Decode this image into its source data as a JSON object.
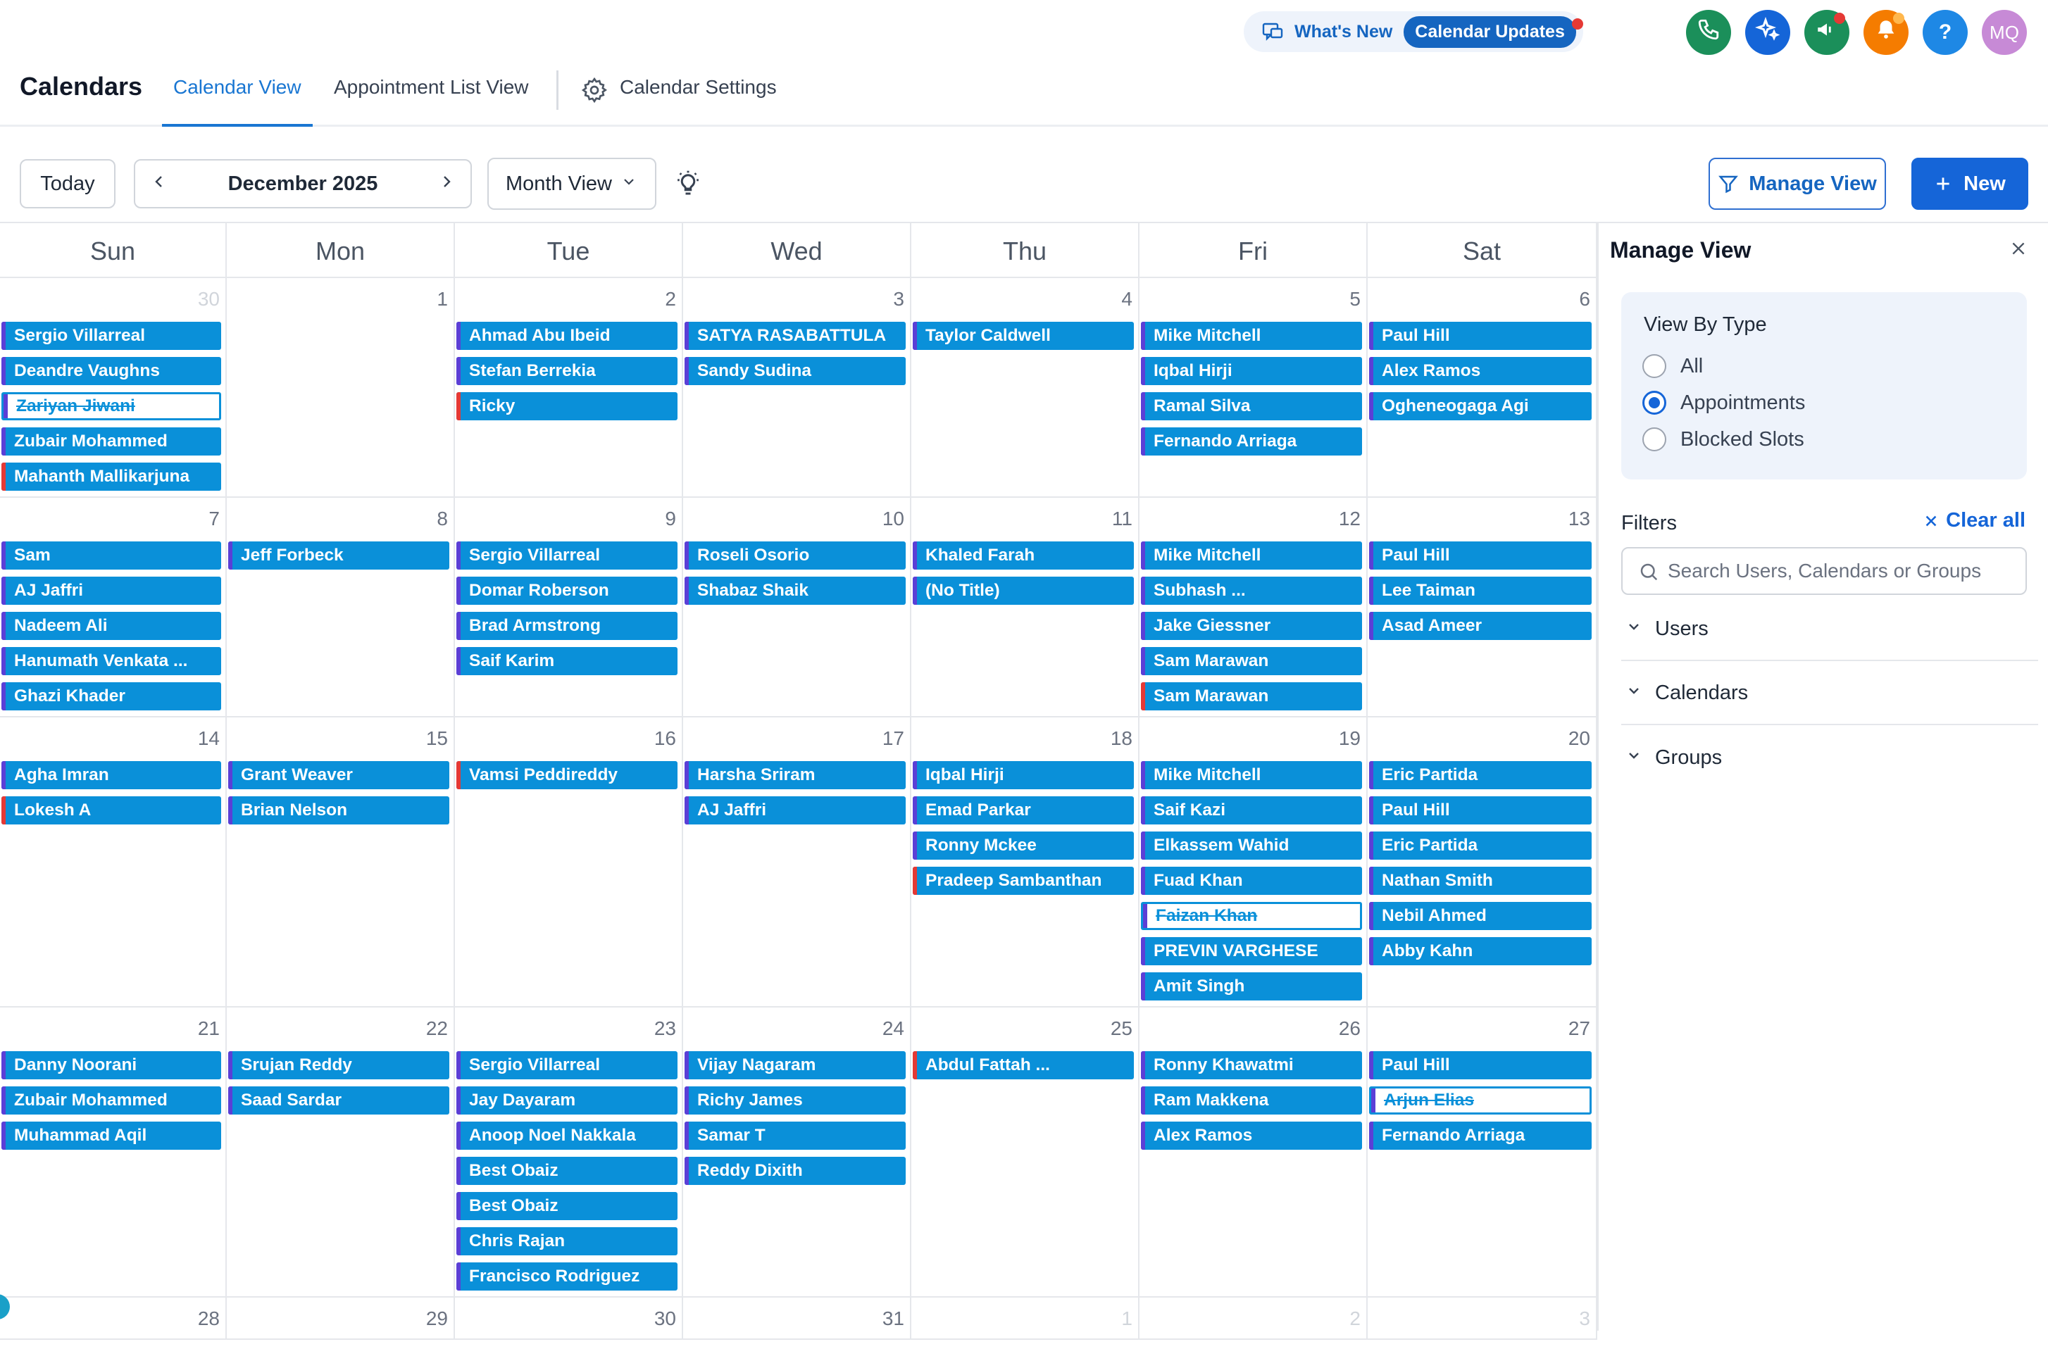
{
  "topbar": {
    "whats_new_label": "What's New",
    "calendar_updates_label": "Calendar Updates",
    "avatar_initials": "MQ",
    "help_label": "?",
    "icons": {
      "phone": {
        "name": "phone-icon",
        "color": "#1b8f5a"
      },
      "ai": {
        "name": "sparkle-icon",
        "color": "#1565d8"
      },
      "announce": {
        "name": "megaphone-icon",
        "color": "#1b8f5a"
      },
      "bell": {
        "name": "bell-icon",
        "color": "#f57c00"
      },
      "help": {
        "name": "help-icon",
        "color": "#1e88e5"
      },
      "avatar": {
        "color": "#c78ad6"
      }
    }
  },
  "header": {
    "title": "Calendars",
    "tabs": [
      "Calendar View",
      "Appointment List View",
      "Calendar Settings"
    ],
    "active_tab": "Calendar View"
  },
  "toolbar": {
    "today_label": "Today",
    "month_label": "December 2025",
    "view_label": "Month View",
    "manage_view_label": "Manage View",
    "new_label": "New"
  },
  "calendar": {
    "days_of_week": [
      "Sun",
      "Mon",
      "Tue",
      "Wed",
      "Thu",
      "Fri",
      "Sat"
    ],
    "weeks": [
      [
        {
          "num": "30",
          "muted": true,
          "events": [
            {
              "t": "Sergio Villarreal"
            },
            {
              "t": "Deandre Vaughns"
            },
            {
              "t": "Zariyan Jiwani",
              "s": "cancelled"
            },
            {
              "t": "Zubair Mohammed"
            },
            {
              "t": "Mahanth Mallikarjuna",
              "s": "red"
            }
          ]
        },
        {
          "num": "1",
          "events": []
        },
        {
          "num": "2",
          "events": [
            {
              "t": "Ahmad Abu Ibeid"
            },
            {
              "t": "Stefan Berrekia"
            },
            {
              "t": "Ricky",
              "s": "red"
            }
          ]
        },
        {
          "num": "3",
          "events": [
            {
              "t": "SATYA RASABATTULA"
            },
            {
              "t": "Sandy Sudina"
            }
          ]
        },
        {
          "num": "4",
          "events": [
            {
              "t": "Taylor  Caldwell"
            }
          ]
        },
        {
          "num": "5",
          "events": [
            {
              "t": "Mike Mitchell"
            },
            {
              "t": "Iqbal Hirji"
            },
            {
              "t": "Ramal Silva"
            },
            {
              "t": "Fernando Arriaga"
            }
          ]
        },
        {
          "num": "6",
          "events": [
            {
              "t": "Paul Hill"
            },
            {
              "t": "Alex Ramos"
            },
            {
              "t": "Ogheneogaga Agi"
            }
          ]
        }
      ],
      [
        {
          "num": "7",
          "events": [
            {
              "t": "Sam"
            },
            {
              "t": "AJ Jaffri"
            },
            {
              "t": "Nadeem Ali"
            },
            {
              "t": "Hanumath Venkata ..."
            },
            {
              "t": "Ghazi Khader"
            }
          ]
        },
        {
          "num": "8",
          "events": [
            {
              "t": "Jeff Forbeck"
            }
          ]
        },
        {
          "num": "9",
          "events": [
            {
              "t": "Sergio Villarreal"
            },
            {
              "t": "Domar Roberson"
            },
            {
              "t": "Brad Armstrong"
            },
            {
              "t": "Saif Karim"
            }
          ]
        },
        {
          "num": "10",
          "events": [
            {
              "t": "Roseli Osorio"
            },
            {
              "t": "Shabaz Shaik"
            }
          ]
        },
        {
          "num": "11",
          "events": [
            {
              "t": "Khaled Farah"
            },
            {
              "t": "(No Title)"
            }
          ]
        },
        {
          "num": "12",
          "events": [
            {
              "t": "Mike Mitchell"
            },
            {
              "t": "Subhash ..."
            },
            {
              "t": "Jake Giessner"
            },
            {
              "t": "Sam Marawan"
            },
            {
              "t": "Sam Marawan",
              "s": "red"
            }
          ]
        },
        {
          "num": "13",
          "events": [
            {
              "t": "Paul Hill"
            },
            {
              "t": "Lee Taiman"
            },
            {
              "t": "Asad Ameer"
            }
          ]
        }
      ],
      [
        {
          "num": "14",
          "events": [
            {
              "t": "Agha Imran"
            },
            {
              "t": "Lokesh A",
              "s": "red"
            }
          ]
        },
        {
          "num": "15",
          "events": [
            {
              "t": "Grant Weaver"
            },
            {
              "t": "Brian Nelson"
            }
          ]
        },
        {
          "num": "16",
          "events": [
            {
              "t": "Vamsi Peddireddy",
              "s": "red"
            }
          ]
        },
        {
          "num": "17",
          "events": [
            {
              "t": "Harsha Sriram"
            },
            {
              "t": "AJ Jaffri"
            }
          ]
        },
        {
          "num": "18",
          "events": [
            {
              "t": "Iqbal Hirji"
            },
            {
              "t": "Emad Parkar"
            },
            {
              "t": "Ronny Mckee"
            },
            {
              "t": "Pradeep Sambanthan",
              "s": "red"
            }
          ]
        },
        {
          "num": "19",
          "events": [
            {
              "t": "Mike Mitchell"
            },
            {
              "t": "Saif Kazi"
            },
            {
              "t": "Elkassem Wahid"
            },
            {
              "t": "Fuad Khan"
            },
            {
              "t": "Faizan Khan",
              "s": "cancelled"
            },
            {
              "t": "PREVIN VARGHESE"
            },
            {
              "t": "Amit Singh"
            }
          ]
        },
        {
          "num": "20",
          "events": [
            {
              "t": "Eric Partida"
            },
            {
              "t": "Paul Hill"
            },
            {
              "t": "Eric Partida"
            },
            {
              "t": "Nathan Smith"
            },
            {
              "t": "Nebil Ahmed"
            },
            {
              "t": "Abby Kahn"
            }
          ]
        }
      ],
      [
        {
          "num": "21",
          "events": [
            {
              "t": "Danny Noorani"
            },
            {
              "t": "Zubair Mohammed"
            },
            {
              "t": "Muhammad Aqil"
            }
          ]
        },
        {
          "num": "22",
          "events": [
            {
              "t": "Srujan Reddy"
            },
            {
              "t": "Saad Sardar"
            }
          ]
        },
        {
          "num": "23",
          "events": [
            {
              "t": "Sergio Villarreal"
            },
            {
              "t": "Jay Dayaram"
            },
            {
              "t": "Anoop Noel Nakkala"
            },
            {
              "t": "Best Obaiz"
            },
            {
              "t": "Best Obaiz"
            },
            {
              "t": "Chris Rajan"
            },
            {
              "t": "Francisco Rodriguez"
            }
          ]
        },
        {
          "num": "24",
          "events": [
            {
              "t": "Vijay Nagaram"
            },
            {
              "t": "Richy James"
            },
            {
              "t": "Samar T"
            },
            {
              "t": "Reddy Dixith"
            }
          ]
        },
        {
          "num": "25",
          "events": [
            {
              "t": "Abdul Fattah ...",
              "s": "red"
            }
          ]
        },
        {
          "num": "26",
          "events": [
            {
              "t": "Ronny Khawatmi"
            },
            {
              "t": "Ram Makkena"
            },
            {
              "t": "Alex Ramos"
            }
          ]
        },
        {
          "num": "27",
          "events": [
            {
              "t": "Paul Hill"
            },
            {
              "t": "Arjun Elias",
              "s": "cancelled"
            },
            {
              "t": "Fernando Arriaga"
            }
          ]
        }
      ],
      [
        {
          "num": "28",
          "events": []
        },
        {
          "num": "29",
          "events": []
        },
        {
          "num": "30",
          "events": []
        },
        {
          "num": "31",
          "events": []
        },
        {
          "num": "1",
          "muted": true,
          "events": []
        },
        {
          "num": "2",
          "muted": true,
          "events": []
        },
        {
          "num": "3",
          "muted": true,
          "events": []
        }
      ]
    ]
  },
  "panel": {
    "title": "Manage View",
    "view_by_type_label": "View By Type",
    "options": [
      "All",
      "Appointments",
      "Blocked Slots"
    ],
    "selected_option": "Appointments",
    "filters_label": "Filters",
    "clear_all_label": "Clear all",
    "search_placeholder": "Search Users, Calendars or Groups",
    "sections": [
      "Users",
      "Calendars",
      "Groups"
    ]
  },
  "colors": {
    "event_bg": "#0a90d9",
    "event_stripe": "#5b3fd6",
    "event_stripe_alt": "#e53935",
    "accent": "#1565d8"
  }
}
